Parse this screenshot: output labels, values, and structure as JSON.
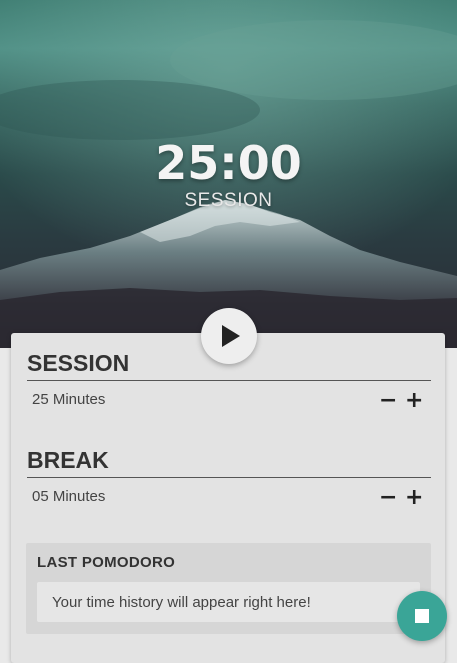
{
  "timer": {
    "display": "25:00",
    "mode": "SESSION"
  },
  "session": {
    "title": "SESSION",
    "value": "25 Minutes",
    "decrement": "−",
    "increment": "+"
  },
  "break": {
    "title": "BREAK",
    "value": "05 Minutes",
    "decrement": "−",
    "increment": "+"
  },
  "history": {
    "title": "LAST POMODORO",
    "empty_message": "Your time history will appear right here!"
  },
  "icons": {
    "play": "play-icon",
    "stop": "stop-icon",
    "background": "mountain-photo"
  },
  "colors": {
    "accent": "#3aa597",
    "panel": "#e3e3e3",
    "text": "#333333"
  }
}
